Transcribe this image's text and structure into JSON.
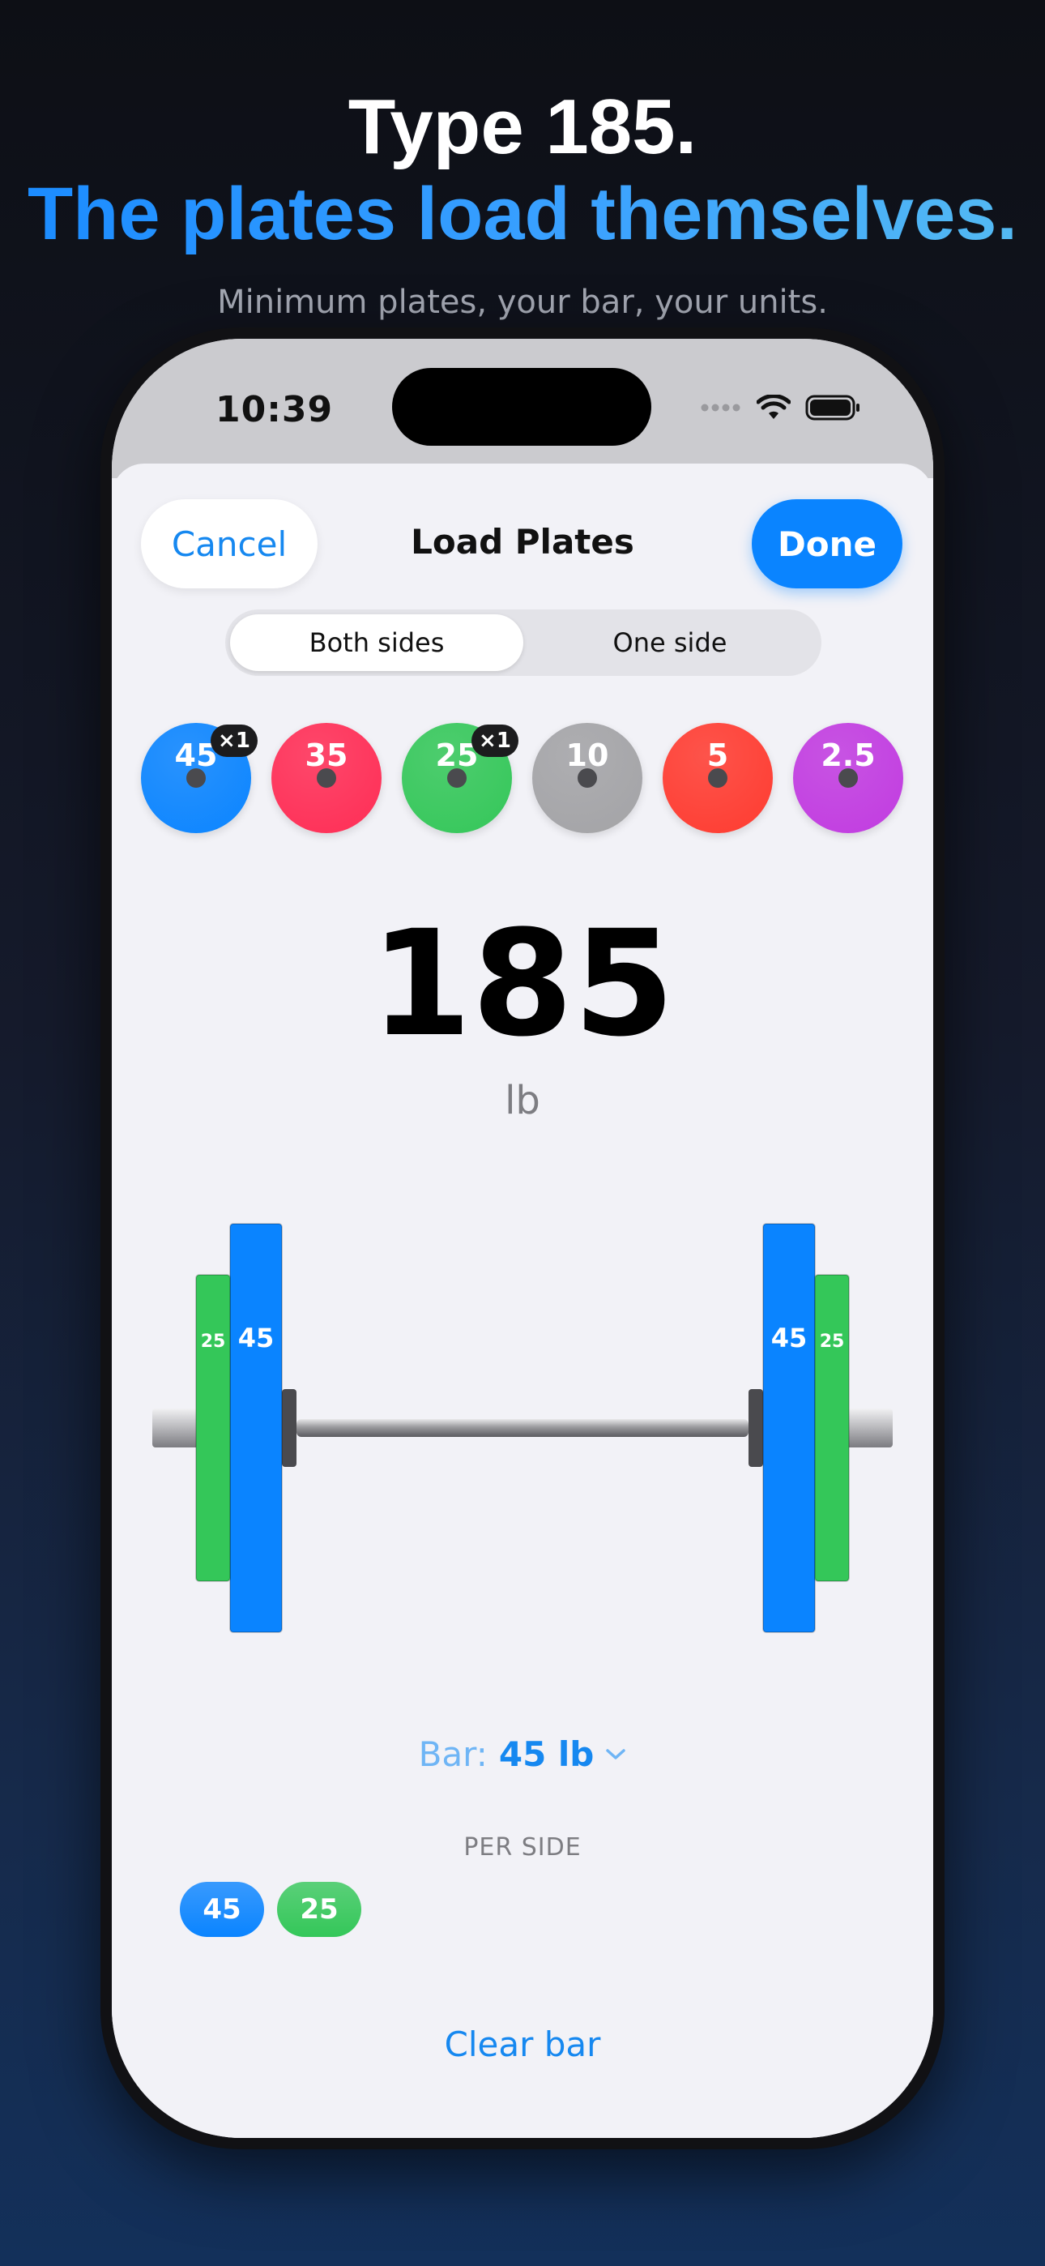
{
  "marketing": {
    "title": "Type 185.",
    "subtitle": "The plates load themselves.",
    "tagline": "Minimum plates, your bar, your units."
  },
  "status_bar": {
    "time": "10:39",
    "icons": [
      "cellular-dots-icon",
      "wifi-icon",
      "battery-icon"
    ]
  },
  "sheet": {
    "title": "Load Plates",
    "cancel_label": "Cancel",
    "done_label": "Done"
  },
  "segmented": {
    "options": [
      "Both sides",
      "One side"
    ],
    "selected": "Both sides"
  },
  "plate_picker": [
    {
      "value": "45",
      "color": "#0a84ff",
      "count": "×1"
    },
    {
      "value": "35",
      "color": "#ff2d55",
      "count": ""
    },
    {
      "value": "25",
      "color": "#34c759",
      "count": "×1"
    },
    {
      "value": "10",
      "color": "#a3a3a6",
      "count": ""
    },
    {
      "value": "5",
      "color": "#ff3b30",
      "count": ""
    },
    {
      "value": "2.5",
      "color": "#c13be0",
      "count": ""
    }
  ],
  "total": {
    "weight": "185",
    "unit": "lb"
  },
  "barbell": {
    "loaded_per_side": [
      {
        "value": "45",
        "color": "#0a84ff"
      },
      {
        "value": "25",
        "color": "#34c759"
      }
    ]
  },
  "bar": {
    "label": "Bar:",
    "value": "45 lb"
  },
  "per_side": {
    "title": "PER SIDE",
    "chips": [
      {
        "value": "45",
        "color": "#0a84ff"
      },
      {
        "value": "25",
        "color": "#34c759"
      }
    ]
  },
  "clear_label": "Clear bar",
  "colors": {
    "accent": "#0a84ff",
    "link": "#1688f0"
  }
}
